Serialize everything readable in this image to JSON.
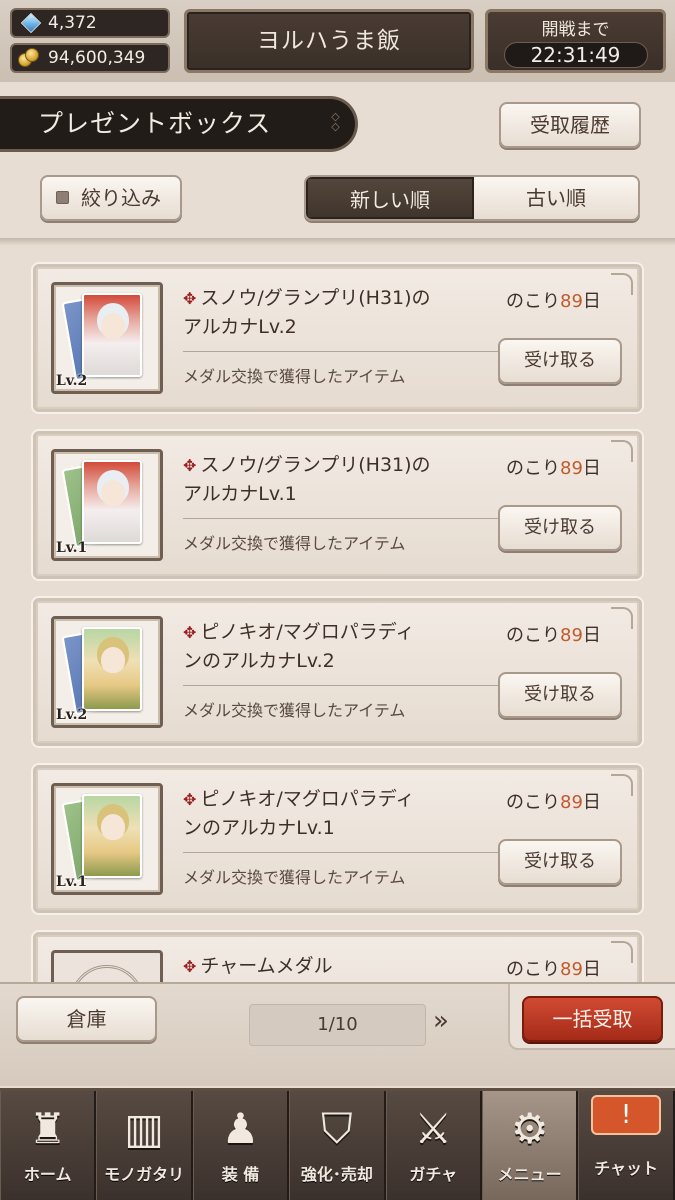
{
  "status": {
    "gems": "4,372",
    "coins": "94,600,349",
    "guild_name": "ヨルハうま飯",
    "timer_label": "開戦まで",
    "timer_value": "22:31:49"
  },
  "header": {
    "title": "プレゼントボックス",
    "history_label": "受取履歴",
    "filter_label": "絞り込み",
    "sort_new": "新しい順",
    "sort_old": "古い順"
  },
  "items": [
    {
      "name_line1": "スノウ/グランプリ(H31)の",
      "name_line2": "アルカナLv.2",
      "remain_prefix": "のこり",
      "remain_days": "89",
      "remain_suffix": "日",
      "desc": "メダル交換で獲得したアイテム",
      "button": "受け取る",
      "level": "Lv.2",
      "icon": "snow-card-icon"
    },
    {
      "name_line1": "スノウ/グランプリ(H31)の",
      "name_line2": "アルカナLv.1",
      "remain_prefix": "のこり",
      "remain_days": "89",
      "remain_suffix": "日",
      "desc": "メダル交換で獲得したアイテム",
      "button": "受け取る",
      "level": "Lv.1",
      "icon": "snow-card-icon"
    },
    {
      "name_line1": "ピノキオ/マグロパラディ",
      "name_line2": "ンのアルカナLv.2",
      "remain_prefix": "のこり",
      "remain_days": "89",
      "remain_suffix": "日",
      "desc": "メダル交換で獲得したアイテム",
      "button": "受け取る",
      "level": "Lv.2",
      "icon": "pinocchio-card-icon"
    },
    {
      "name_line1": "ピノキオ/マグロパラディ",
      "name_line2": "ンのアルカナLv.1",
      "remain_prefix": "のこり",
      "remain_days": "89",
      "remain_suffix": "日",
      "desc": "メダル交換で獲得したアイテム",
      "button": "受け取る",
      "level": "Lv.1",
      "icon": "pinocchio-card-icon"
    },
    {
      "name_line1": "チャームメダル",
      "name_line2": "",
      "remain_prefix": "のこり",
      "remain_days": "89",
      "remain_suffix": "日",
      "desc": "",
      "button": "",
      "level": "",
      "icon": "charm-medal-icon"
    }
  ],
  "footer": {
    "storage_label": "倉庫",
    "page": "1/10",
    "next_icon": "double-chevron-right-icon",
    "collect_all_label": "一括受取"
  },
  "nav": [
    {
      "label": "ホーム",
      "icon": "castle-icon"
    },
    {
      "label": "モノガタリ",
      "icon": "book-icon"
    },
    {
      "label": "装 備",
      "icon": "puppet-icon"
    },
    {
      "label": "強化･売却",
      "icon": "mask-icon"
    },
    {
      "label": "ガチャ",
      "icon": "crossed-swords-icon"
    },
    {
      "label": "メニュー",
      "icon": "gears-icon"
    },
    {
      "label": "チャット",
      "icon": "chat-bubble-icon"
    }
  ],
  "colors": {
    "accent_red": "#a52b18",
    "remain_days": "#c25a2e",
    "clover": "#9c1d1d"
  }
}
